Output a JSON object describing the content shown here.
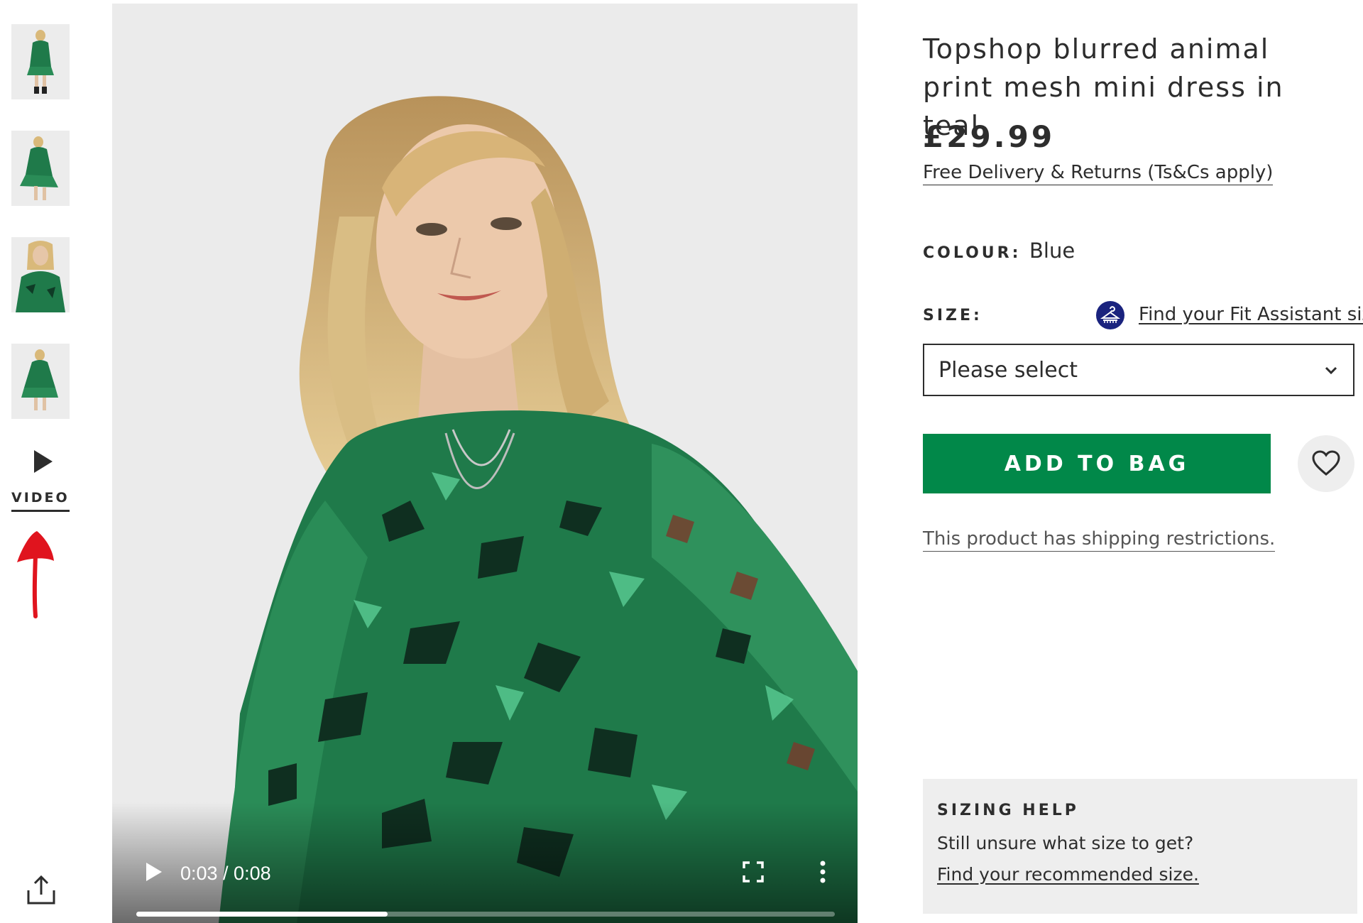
{
  "product": {
    "title": "Topshop blurred animal print mesh mini dress in teal",
    "price": "£29.99",
    "delivery_link": "Free Delivery & Returns (Ts&Cs apply)",
    "colour_label": "COLOUR:",
    "colour_value": "Blue",
    "size_label": "SIZE:",
    "fit_assistant_link": "Find your Fit Assistant size",
    "size_select_value": "Please select",
    "add_to_bag_label": "ADD TO BAG",
    "shipping_note": "This product has shipping restrictions."
  },
  "sizing_help": {
    "title": "SIZING HELP",
    "text": "Still unsure what size to get?",
    "link": "Find your recommended size."
  },
  "gallery": {
    "video_label": "VIDEO",
    "thumbnail_count": 4
  },
  "video_player": {
    "time": "0:03 / 0:08",
    "progress": 0.36
  },
  "colors": {
    "accent_green": "#018849",
    "text": "#2d2d2d",
    "panel_grey": "#eeeeee",
    "annotation_red": "#e0141e",
    "dress_teal": "#1f7a4a"
  },
  "icons": [
    "play-icon",
    "share-icon",
    "fullscreen-icon",
    "more-options-icon",
    "hanger-icon",
    "chevron-down-icon",
    "heart-icon",
    "red-arrow-annotation"
  ]
}
